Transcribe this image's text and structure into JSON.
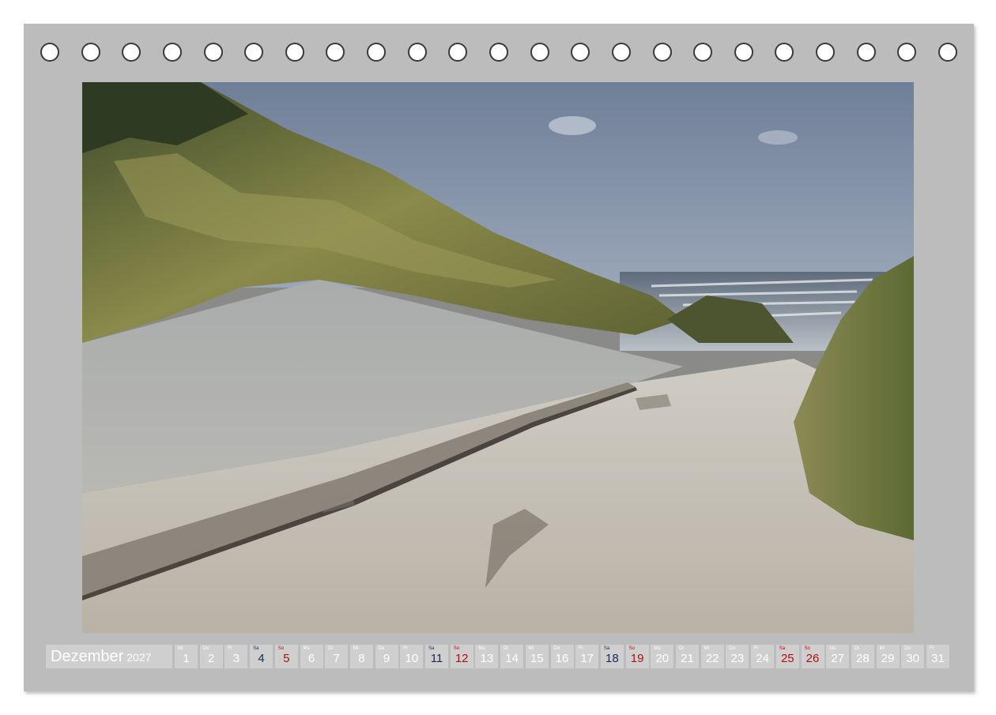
{
  "calendar": {
    "month": "Dezember",
    "year": "2027",
    "days": [
      {
        "wd": "Mi",
        "num": "1",
        "type": "weekday"
      },
      {
        "wd": "Do",
        "num": "2",
        "type": "weekday"
      },
      {
        "wd": "Fr",
        "num": "3",
        "type": "weekday"
      },
      {
        "wd": "Sa",
        "num": "4",
        "type": "sat"
      },
      {
        "wd": "So",
        "num": "5",
        "type": "sun"
      },
      {
        "wd": "Mo",
        "num": "6",
        "type": "weekday"
      },
      {
        "wd": "Di",
        "num": "7",
        "type": "weekday"
      },
      {
        "wd": "Mi",
        "num": "8",
        "type": "weekday"
      },
      {
        "wd": "Do",
        "num": "9",
        "type": "weekday"
      },
      {
        "wd": "Fr",
        "num": "10",
        "type": "weekday"
      },
      {
        "wd": "Sa",
        "num": "11",
        "type": "sat"
      },
      {
        "wd": "So",
        "num": "12",
        "type": "sun"
      },
      {
        "wd": "Mo",
        "num": "13",
        "type": "weekday"
      },
      {
        "wd": "Di",
        "num": "14",
        "type": "weekday"
      },
      {
        "wd": "Mi",
        "num": "15",
        "type": "weekday"
      },
      {
        "wd": "Do",
        "num": "16",
        "type": "weekday"
      },
      {
        "wd": "Fr",
        "num": "17",
        "type": "weekday"
      },
      {
        "wd": "Sa",
        "num": "18",
        "type": "sat"
      },
      {
        "wd": "So",
        "num": "19",
        "type": "sun"
      },
      {
        "wd": "Mo",
        "num": "20",
        "type": "weekday"
      },
      {
        "wd": "Di",
        "num": "21",
        "type": "weekday"
      },
      {
        "wd": "Mi",
        "num": "22",
        "type": "weekday"
      },
      {
        "wd": "Do",
        "num": "23",
        "type": "weekday"
      },
      {
        "wd": "Fr",
        "num": "24",
        "type": "weekday"
      },
      {
        "wd": "Sa",
        "num": "25",
        "type": "hol"
      },
      {
        "wd": "So",
        "num": "26",
        "type": "sun"
      },
      {
        "wd": "Mo",
        "num": "27",
        "type": "weekday"
      },
      {
        "wd": "Di",
        "num": "28",
        "type": "weekday"
      },
      {
        "wd": "Mi",
        "num": "29",
        "type": "weekday"
      },
      {
        "wd": "Do",
        "num": "30",
        "type": "weekday"
      },
      {
        "wd": "Fr",
        "num": "31",
        "type": "weekday"
      }
    ],
    "colors": {
      "background": "#bcbcbc",
      "cell": "#cfcfcf",
      "saturday": "#1a2c55",
      "sunday_holiday": "#b01010"
    }
  },
  "binding": {
    "hole_count": 23
  },
  "photo": {
    "subject": "beach-path-through-dunes-image"
  }
}
